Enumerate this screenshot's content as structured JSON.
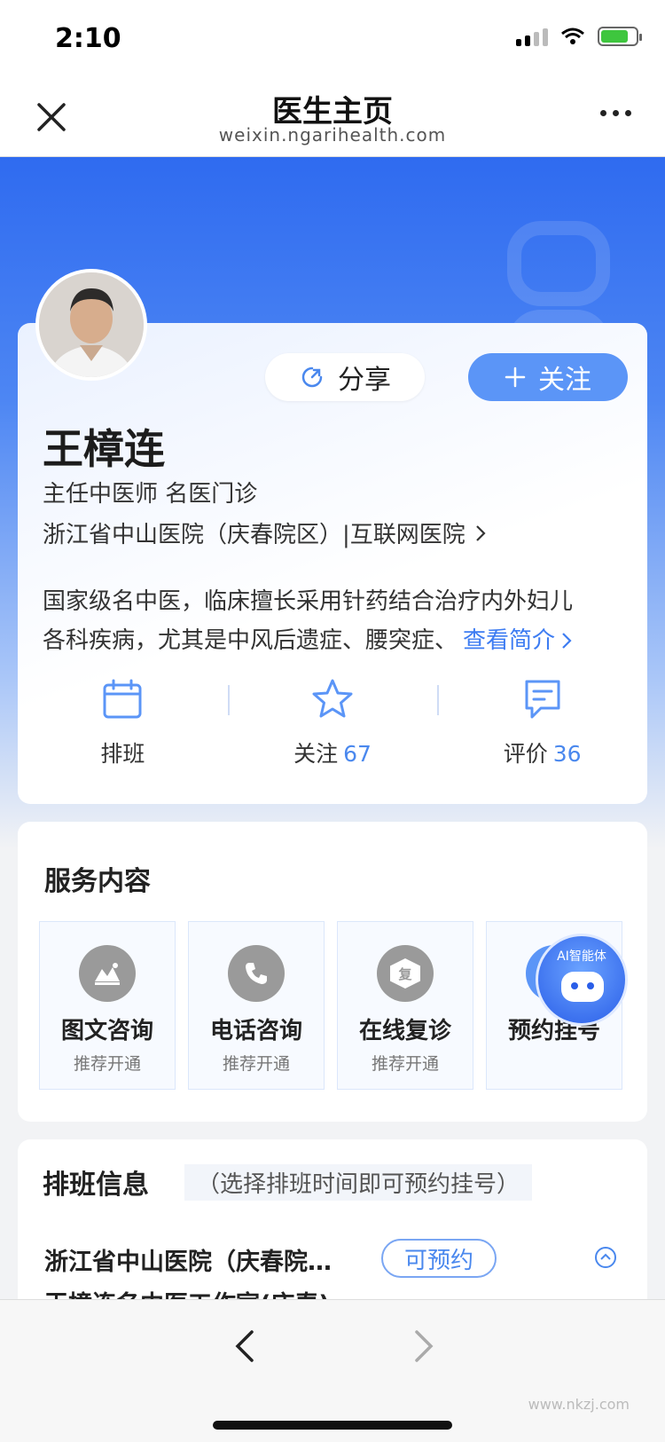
{
  "status_bar": {
    "time": "2:10"
  },
  "nav": {
    "title": "医生主页",
    "url": "weixin.ngarihealth.com"
  },
  "doctor": {
    "share_label": "分享",
    "follow_label": "关注",
    "name": "王樟连",
    "title": "主任中医师 名医门诊",
    "hospital": "浙江省中山医院（庆春院区）|互联网医院",
    "intro_line1": "国家级名中医，临床擅长采用针药结合治疗内外妇儿",
    "intro_line2": "各科疾病，尤其是中风后遗症、腰突症、",
    "intro_more": "查看简介",
    "stats": [
      {
        "label": "排班",
        "count": ""
      },
      {
        "label": "关注",
        "count": "67"
      },
      {
        "label": "评价",
        "count": "36"
      }
    ]
  },
  "services": {
    "title": "服务内容",
    "items": [
      {
        "name": "图文咨询",
        "sub": "推荐开通"
      },
      {
        "name": "电话咨询",
        "sub": "推荐开通"
      },
      {
        "name": "在线复诊",
        "sub": "推荐开通",
        "icon_text": "复"
      },
      {
        "name": "预约挂号",
        "sub": ""
      }
    ],
    "ai_label": "AI智能体"
  },
  "schedule": {
    "title": "排班信息",
    "note": "（选择排班时间即可预约挂号）",
    "hospital": "浙江省中山医院（庆春院…",
    "badge": "可预约",
    "sub": "王樟连名中医工作室(庆春)"
  },
  "footer": {
    "watermark": "www.nkzj.com"
  },
  "colors": {
    "accent": "#3d7cf2",
    "hero": "#2f6bf0",
    "follow_button": "#5b95f7"
  }
}
